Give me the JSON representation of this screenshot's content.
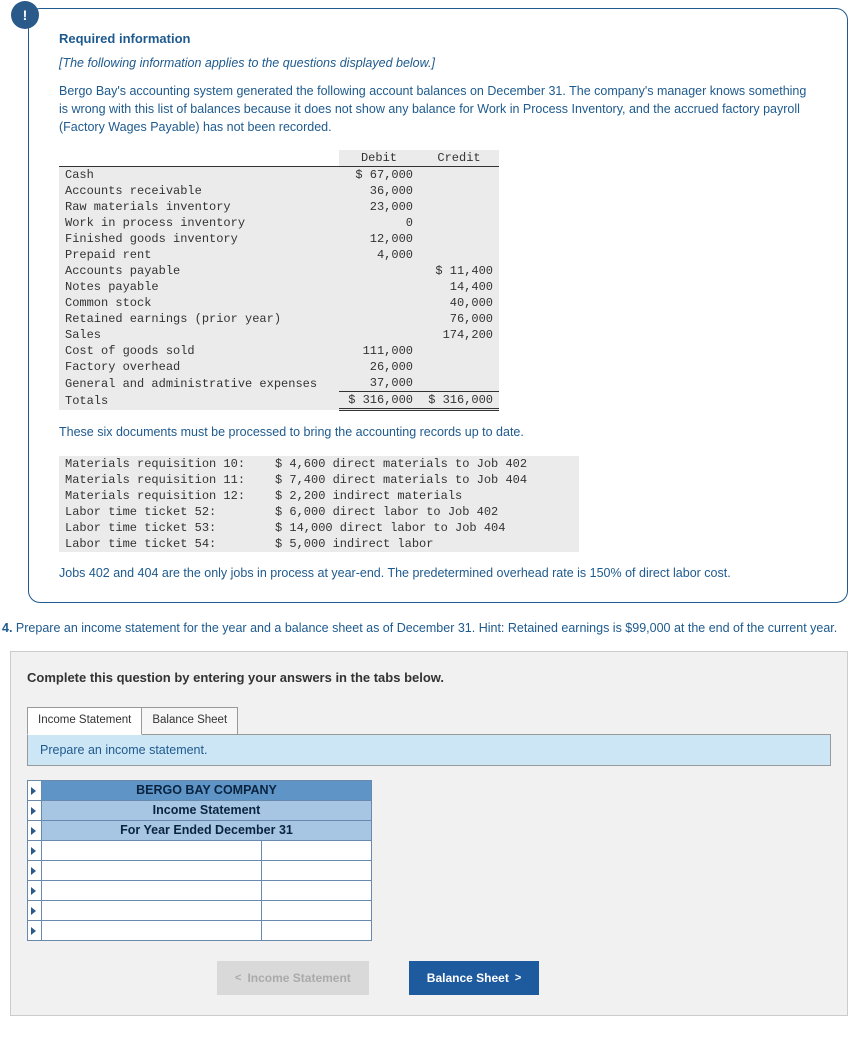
{
  "header": {
    "title": "Required information",
    "applies_note": "[The following information applies to the questions displayed below.]",
    "intro": "Bergo Bay's accounting system generated the following account balances on December 31. The company's manager knows something is wrong with this list of balances because it does not show any balance for Work in Process Inventory, and the accrued factory payroll (Factory Wages Payable) has not been recorded."
  },
  "trial": {
    "col_debit": "Debit",
    "col_credit": "Credit",
    "rows": [
      {
        "acct": "Cash",
        "debit": "$ 67,000",
        "credit": ""
      },
      {
        "acct": "Accounts receivable",
        "debit": "36,000",
        "credit": ""
      },
      {
        "acct": "Raw materials inventory",
        "debit": "23,000",
        "credit": ""
      },
      {
        "acct": "Work in process inventory",
        "debit": "0",
        "credit": ""
      },
      {
        "acct": "Finished goods inventory",
        "debit": "12,000",
        "credit": ""
      },
      {
        "acct": "Prepaid rent",
        "debit": "4,000",
        "credit": ""
      },
      {
        "acct": "Accounts payable",
        "debit": "",
        "credit": "$ 11,400"
      },
      {
        "acct": "Notes payable",
        "debit": "",
        "credit": "14,400"
      },
      {
        "acct": "Common stock",
        "debit": "",
        "credit": "40,000"
      },
      {
        "acct": "Retained earnings (prior year)",
        "debit": "",
        "credit": "76,000"
      },
      {
        "acct": "Sales",
        "debit": "",
        "credit": "174,200"
      },
      {
        "acct": "Cost of goods sold",
        "debit": "111,000",
        "credit": ""
      },
      {
        "acct": "Factory overhead",
        "debit": "26,000",
        "credit": ""
      },
      {
        "acct": "General and administrative expenses",
        "debit": "37,000",
        "credit": ""
      }
    ],
    "totals_label": "Totals",
    "totals_debit": "$ 316,000",
    "totals_credit": "$ 316,000"
  },
  "docs_intro": "These six documents must be processed to bring the accounting records up to date.",
  "docs": [
    {
      "c1": "Materials requisition 10:",
      "c2": "$ 4,600 direct materials to Job 402"
    },
    {
      "c1": "Materials requisition 11:",
      "c2": "$ 7,400 direct materials to Job 404"
    },
    {
      "c1": "Materials requisition 12:",
      "c2": "$ 2,200 indirect materials"
    },
    {
      "c1": "Labor time ticket 52:",
      "c2": "$ 6,000 direct labor to Job 402"
    },
    {
      "c1": "Labor time ticket 53:",
      "c2": "$ 14,000 direct labor to Job 404"
    },
    {
      "c1": "Labor time ticket 54:",
      "c2": "$ 5,000 indirect labor"
    }
  ],
  "jobs_note": "Jobs 402 and 404 are the only jobs in process at year-end. The predetermined overhead rate is 150% of direct labor cost.",
  "question": {
    "num": "4.",
    "text": "Prepare an income statement for the year and a balance sheet as of December 31. Hint: Retained earnings is $99,000 at the end of the current year."
  },
  "answer": {
    "complete": "Complete this question by entering your answers in the tabs below.",
    "tab1": "Income Statement",
    "tab2": "Balance Sheet",
    "panel_instr": "Prepare an income statement.",
    "company": "BERGO BAY COMPANY",
    "stmt_title": "Income Statement",
    "period": "For Year Ended December 31",
    "prev_btn": "Income Statement",
    "next_btn": "Balance Sheet"
  }
}
